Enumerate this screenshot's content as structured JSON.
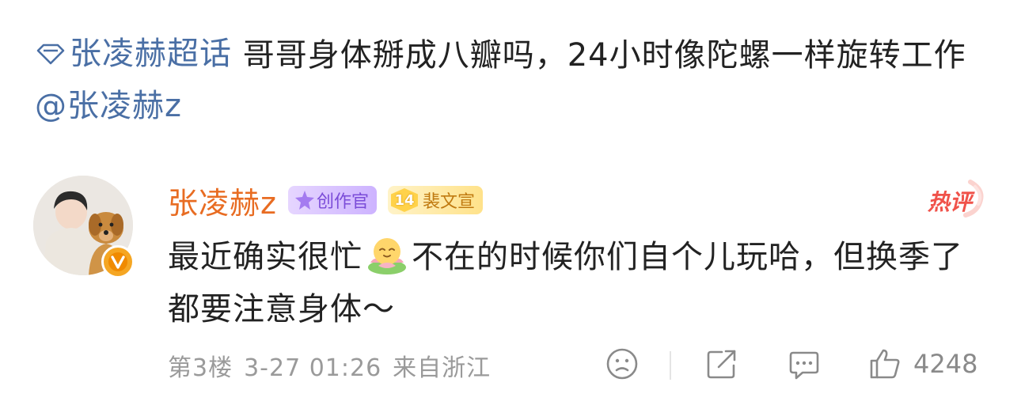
{
  "post": {
    "topic": "张凌赫超话",
    "body": " 哥哥身体掰成八瓣吗，24小时像陀螺一样旋转工作 ",
    "mention": "@张凌赫z"
  },
  "comment": {
    "username": "张凌赫z",
    "badge_creator": "创作官",
    "fan_level": "14",
    "fan_name": "裴文宣",
    "hot_label": "热评",
    "text_before_emoji": "最近确实很忙",
    "text_after_emoji": "不在的时候你们自个儿玩哈，但换季了都要注意身体～",
    "floor": "第3楼",
    "time": "3-27 01:26",
    "location": "来自浙江",
    "like_count": "4248"
  },
  "colors": {
    "link": "#4a6fa5",
    "username": "#e86c22",
    "hot": "#f0524a"
  },
  "icons": [
    "diamond-icon",
    "verified-v-icon",
    "lotus-emoji-icon",
    "sad-face-icon",
    "share-icon",
    "comment-icon",
    "thumbs-up-icon"
  ]
}
